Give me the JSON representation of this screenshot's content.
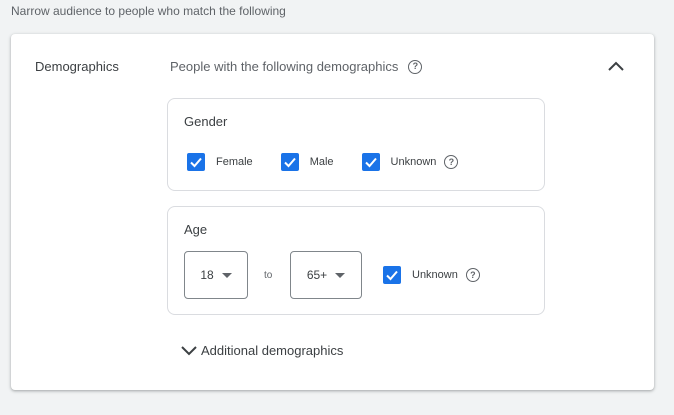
{
  "top_note": "Narrow audience to people who match the following",
  "section": {
    "label": "Demographics",
    "description": "People with the following demographics"
  },
  "gender": {
    "title": "Gender",
    "options": [
      {
        "label": "Female",
        "checked": true
      },
      {
        "label": "Male",
        "checked": true
      },
      {
        "label": "Unknown",
        "checked": true
      }
    ]
  },
  "age": {
    "title": "Age",
    "from": "18",
    "to_label": "to",
    "to": "65+",
    "unknown_label": "Unknown",
    "unknown_checked": true
  },
  "additional_label": "Additional demographics",
  "colors": {
    "accent": "#1a73e8",
    "border": "#dadce0",
    "background": "#f1f3f4"
  },
  "icons": {
    "collapse": "chevron-up-icon",
    "help": "help-circle-icon",
    "expand_more": "chevron-down-icon"
  }
}
